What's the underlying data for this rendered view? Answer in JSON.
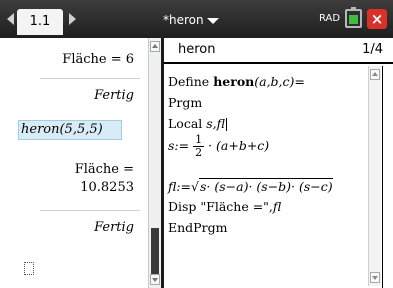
{
  "topbar": {
    "tab_label": "1.1",
    "doc_title": "*heron",
    "mode": "RAD",
    "close_glyph": "×"
  },
  "calc": {
    "result1": "Fläche = 6",
    "result1_done": "Fertig",
    "entry_call": "heron(5,5,5)",
    "result2_label": "Fläche =",
    "result2_value": "10.8253",
    "result2_done": "Fertig"
  },
  "editor": {
    "name": "heron",
    "page": "1/4",
    "line1_prefix": "Define ",
    "line1_name": "heron",
    "line1_args": "(a,b,c)=",
    "line2": "Prgm",
    "line3_prefix": "Local ",
    "line3_vars": "s,fl",
    "line4_prefix": "s:=",
    "line4_num": "1",
    "line4_den": "2",
    "line4_suffix": "· (a+b+c)",
    "line5_prefix": "fl:=√",
    "line5_expr": "s· (s−a)· (s−b)· (s−c)",
    "line6_prefix": "Disp \"Fläche =\",",
    "line6_var": "fl",
    "line7": "EndPrgm"
  },
  "colors": {
    "topbar": "#2a2a2a",
    "selection": "#d8ecf8",
    "close": "#d9302a",
    "battery": "#3fbf3f"
  }
}
